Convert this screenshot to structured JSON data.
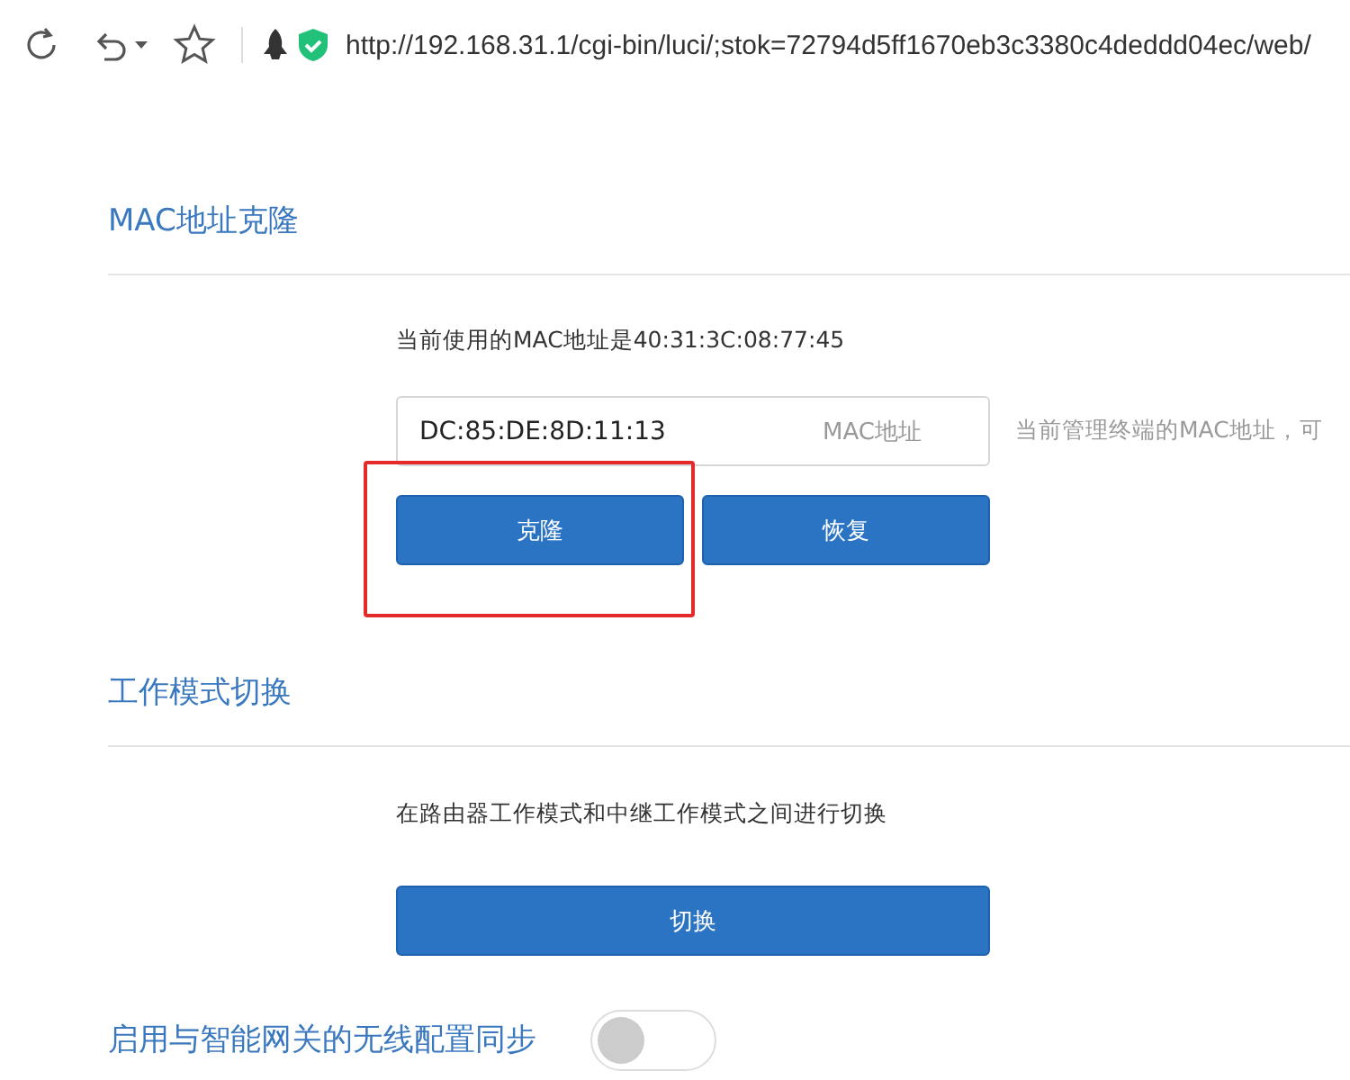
{
  "browser": {
    "url": "http://192.168.31.1/cgi-bin/luci/;stok=72794d5ff1670eb3c3380c4deddd04ec/web/"
  },
  "sections": [
    {
      "kind": "mac",
      "title": "MAC地址克隆",
      "description": "当前使用的MAC地址是40:31:3C:08:77:45",
      "field": {
        "value": "DC:85:DE:8D:11:13",
        "suffix": "MAC地址"
      },
      "hint": "当前管理终端的MAC地址，可",
      "buttons": [
        {
          "label": "克隆",
          "highlighted": true
        },
        {
          "label": "恢复",
          "highlighted": false
        }
      ]
    },
    {
      "kind": "mode",
      "title": "工作模式切换",
      "description": "在路由器工作模式和中继工作模式之间进行切换",
      "buttons": [
        {
          "label": "切换",
          "highlighted": false
        }
      ]
    },
    {
      "kind": "toggle",
      "title": "启用与智能网关的无线配置同步",
      "on": false
    }
  ]
}
